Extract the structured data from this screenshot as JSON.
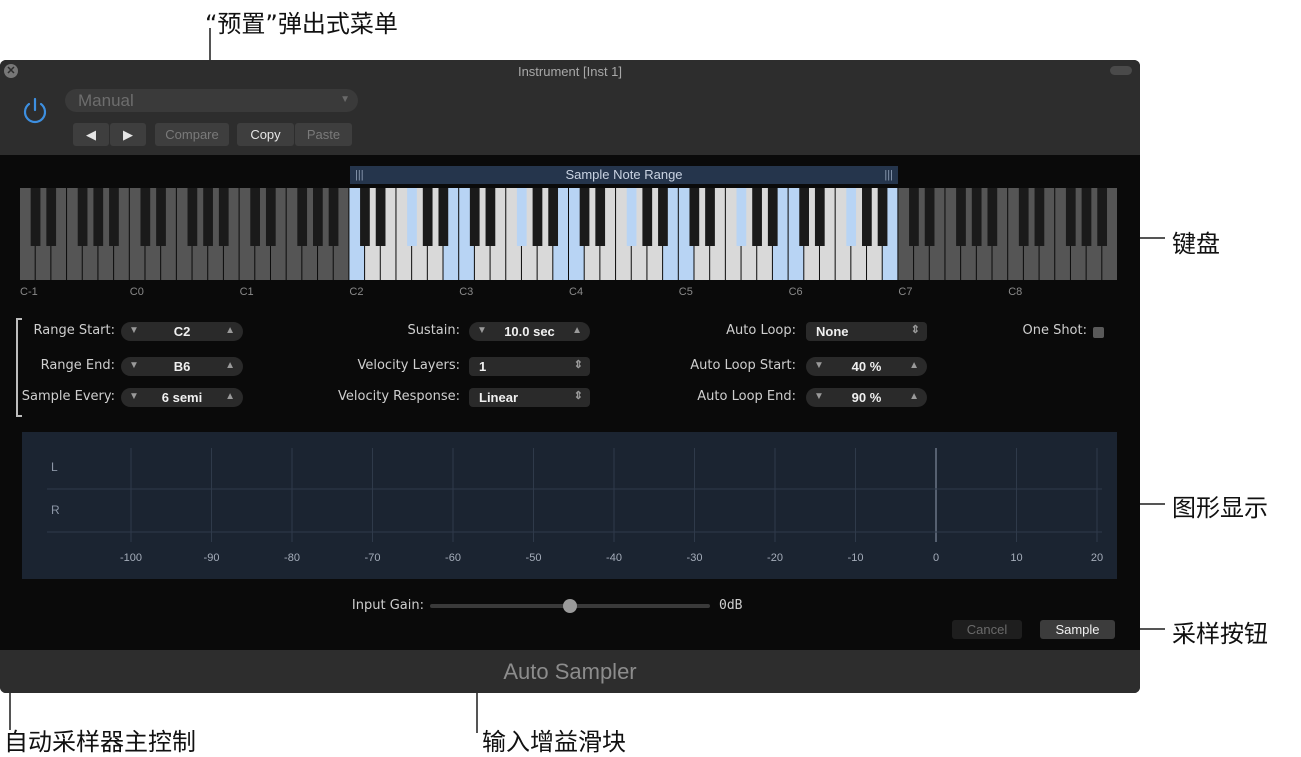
{
  "callouts": {
    "presets_popup": "“预置”弹出式菜单",
    "keyboard": "键盘",
    "graphic_display": "图形显示",
    "sample_button": "采样按钮",
    "main_controls": "自动采样器主控制",
    "input_gain_slider": "输入增益滑块"
  },
  "window": {
    "title": "Instrument [Inst 1]",
    "close_glyph": "✕",
    "footer_title": "Auto Sampler"
  },
  "header": {
    "preset_value": "Manual",
    "preset_arrow": "▼",
    "prev_glyph": "◀",
    "next_glyph": "▶",
    "compare_label": "Compare",
    "copy_label": "Copy",
    "paste_label": "Paste"
  },
  "keyboard": {
    "range_label": "Sample Note Range",
    "grip_glyph": "|||",
    "octave_labels": [
      "C-1",
      "C0",
      "C1",
      "C2",
      "C3",
      "C4",
      "C5",
      "C6",
      "C7",
      "C8"
    ],
    "range_start_note": "C2",
    "range_end_note": "B6",
    "highlight_color": "#b8d4f4"
  },
  "params": {
    "range_start": {
      "label": "Range Start:",
      "value": "C2"
    },
    "range_end": {
      "label": "Range End:",
      "value": "B6"
    },
    "sample_every": {
      "label": "Sample Every:",
      "value": "6 semi"
    },
    "sustain": {
      "label": "Sustain:",
      "value": "10.0 sec"
    },
    "velocity_layers": {
      "label": "Velocity Layers:",
      "value": "1"
    },
    "velocity_response": {
      "label": "Velocity Response:",
      "value": "Linear"
    },
    "auto_loop": {
      "label": "Auto Loop:",
      "value": "None"
    },
    "auto_loop_start": {
      "label": "Auto Loop Start:",
      "value": "40 %"
    },
    "auto_loop_end": {
      "label": "Auto Loop End:",
      "value": "90 %"
    },
    "one_shot": {
      "label": "One Shot:",
      "checked": false
    },
    "down_glyph": "▼",
    "up_glyph": "▲",
    "menu_glyph": "⇕"
  },
  "meter": {
    "left_label": "L",
    "right_label": "R",
    "ticks": [
      "-100",
      "-90",
      "-80",
      "-70",
      "-60",
      "-50",
      "-40",
      "-30",
      "-20",
      "-10",
      "0",
      "10",
      "20"
    ]
  },
  "input_gain": {
    "label": "Input Gain:",
    "value_text": "0dB",
    "level_fraction": 0.5
  },
  "actions": {
    "cancel_label": "Cancel",
    "sample_label": "Sample"
  },
  "colors": {
    "power_icon": "#3d8fe0",
    "window_bg": "#1b1b1b",
    "meter_bg": "#1b2431"
  }
}
